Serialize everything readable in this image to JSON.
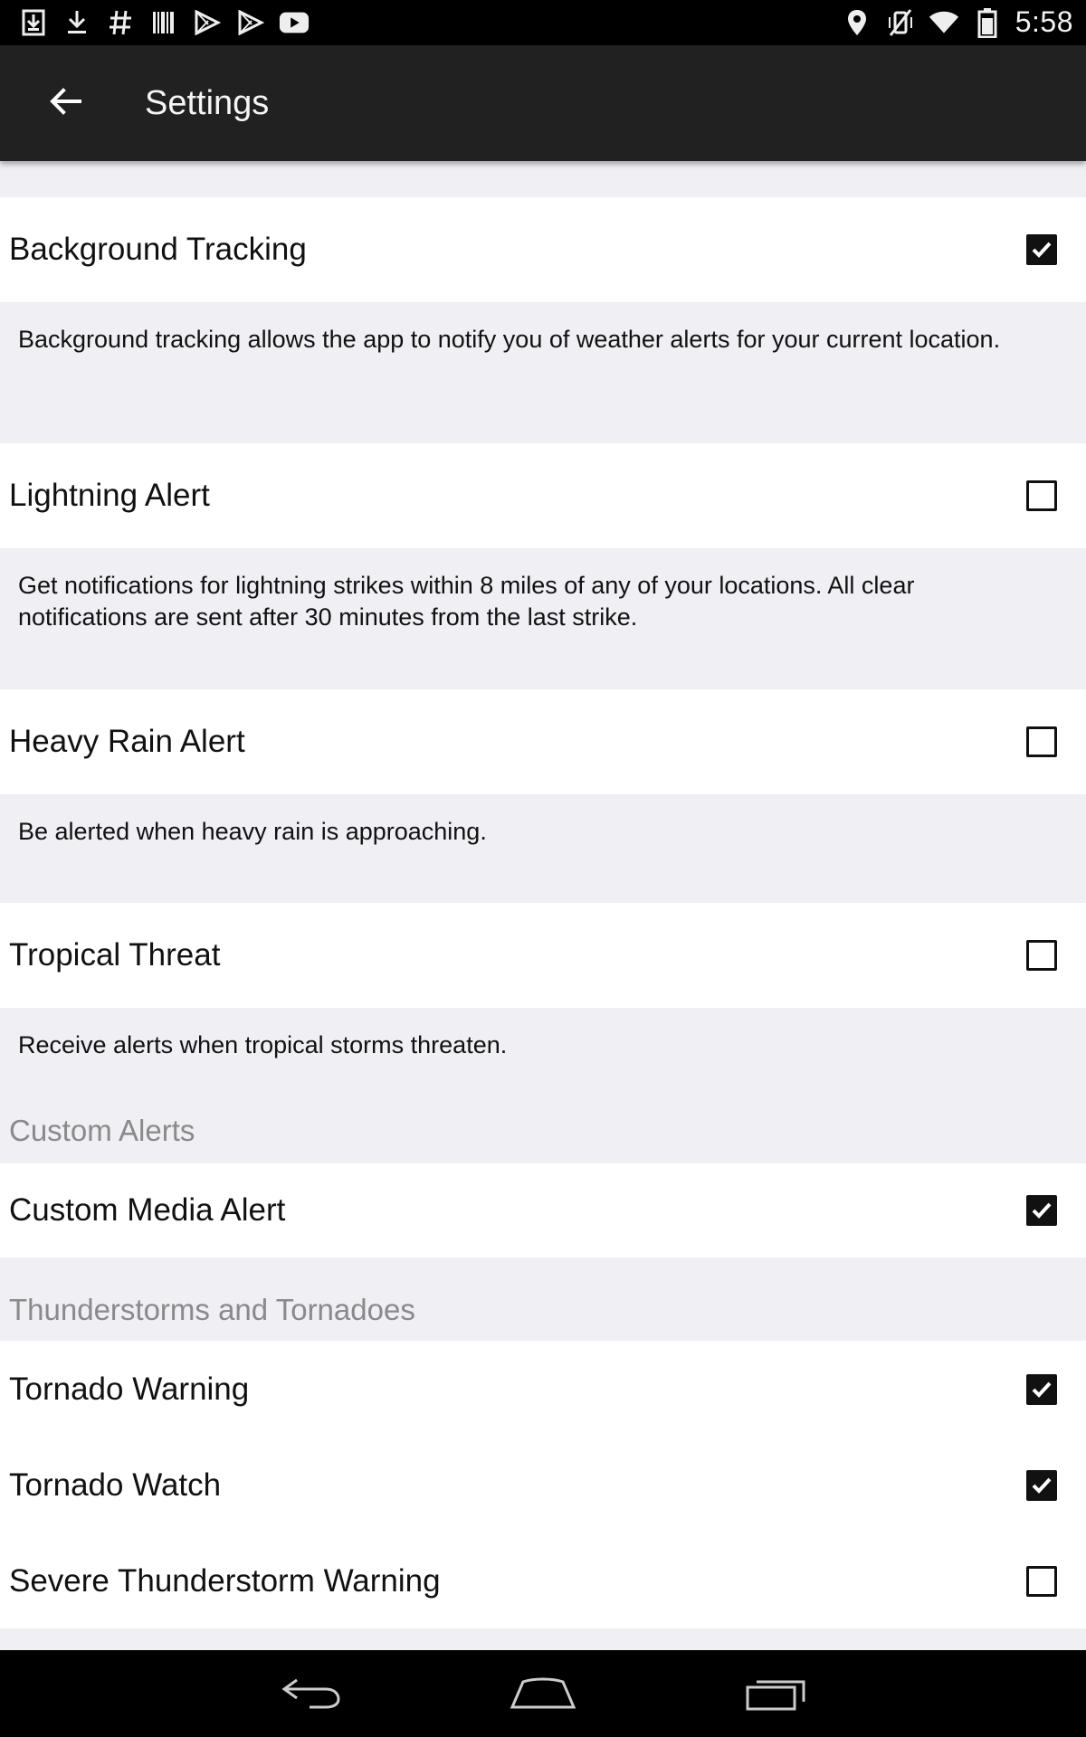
{
  "status_bar": {
    "time": "5:58",
    "left_icons": [
      "download-box-icon",
      "download-icon",
      "hash-icon",
      "barcode-icon",
      "play-store-icon",
      "play-store-icon",
      "youtube-icon"
    ],
    "right_icons": [
      "location-icon",
      "vibrate-off-icon",
      "wifi-icon",
      "battery-icon"
    ]
  },
  "app_bar": {
    "title": "Settings"
  },
  "settings": {
    "background_tracking": {
      "label": "Background Tracking",
      "checked": true,
      "description": "Background tracking allows the app to notify you of weather alerts for your current location."
    },
    "lightning_alert": {
      "label": "Lightning Alert",
      "checked": false,
      "description": "Get notifications for lightning strikes within 8 miles of any of your locations. All clear notifications are sent after 30 minutes from the last strike."
    },
    "heavy_rain_alert": {
      "label": "Heavy Rain Alert",
      "checked": false,
      "description": "Be alerted when heavy rain is approaching."
    },
    "tropical_threat": {
      "label": "Tropical Threat",
      "checked": false,
      "description": "Receive alerts when tropical storms threaten."
    }
  },
  "custom_alerts": {
    "header": "Custom Alerts",
    "custom_media_alert": {
      "label": "Custom Media Alert",
      "checked": true
    }
  },
  "thunderstorms": {
    "header": "Thunderstorms and Tornadoes",
    "tornado_warning": {
      "label": "Tornado Warning",
      "checked": true
    },
    "tornado_watch": {
      "label": "Tornado Watch",
      "checked": true
    },
    "severe_thunderstorm_warning": {
      "label": "Severe Thunderstorm Warning",
      "checked": false
    }
  },
  "nav_bar": {
    "buttons": [
      "back-icon",
      "home-icon",
      "recents-icon"
    ]
  }
}
